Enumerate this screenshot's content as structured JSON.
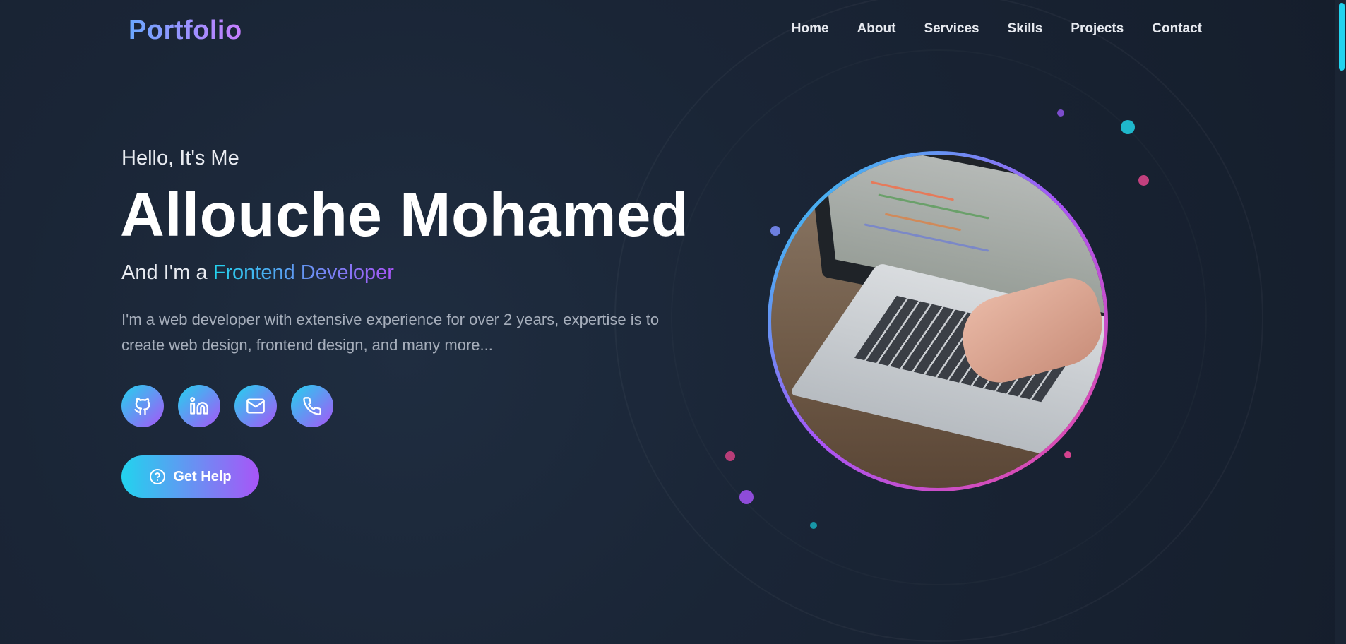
{
  "header": {
    "logo": "Portfolio",
    "nav": [
      "Home",
      "About",
      "Services",
      "Skills",
      "Projects",
      "Contact"
    ]
  },
  "hero": {
    "greeting": "Hello, It's Me",
    "name": "Allouche Mohamed",
    "role_prefix": "And I'm a",
    "role": "Frontend Developer",
    "description": "I'm a web developer with extensive experience for over 2 years, expertise is to create web design, frontend design, and many more...",
    "socials": [
      {
        "icon": "github-icon"
      },
      {
        "icon": "linkedin-icon"
      },
      {
        "icon": "mail-icon"
      },
      {
        "icon": "phone-icon"
      }
    ],
    "cta": {
      "label": "Get Help",
      "icon": "help-circle-icon"
    }
  },
  "image": {
    "alt": "laptop with code on screen"
  },
  "colors": {
    "accent_start": "#22d3ee",
    "accent_mid": "#a855f7",
    "accent_end": "#ec4899",
    "background": "#1a2536"
  }
}
